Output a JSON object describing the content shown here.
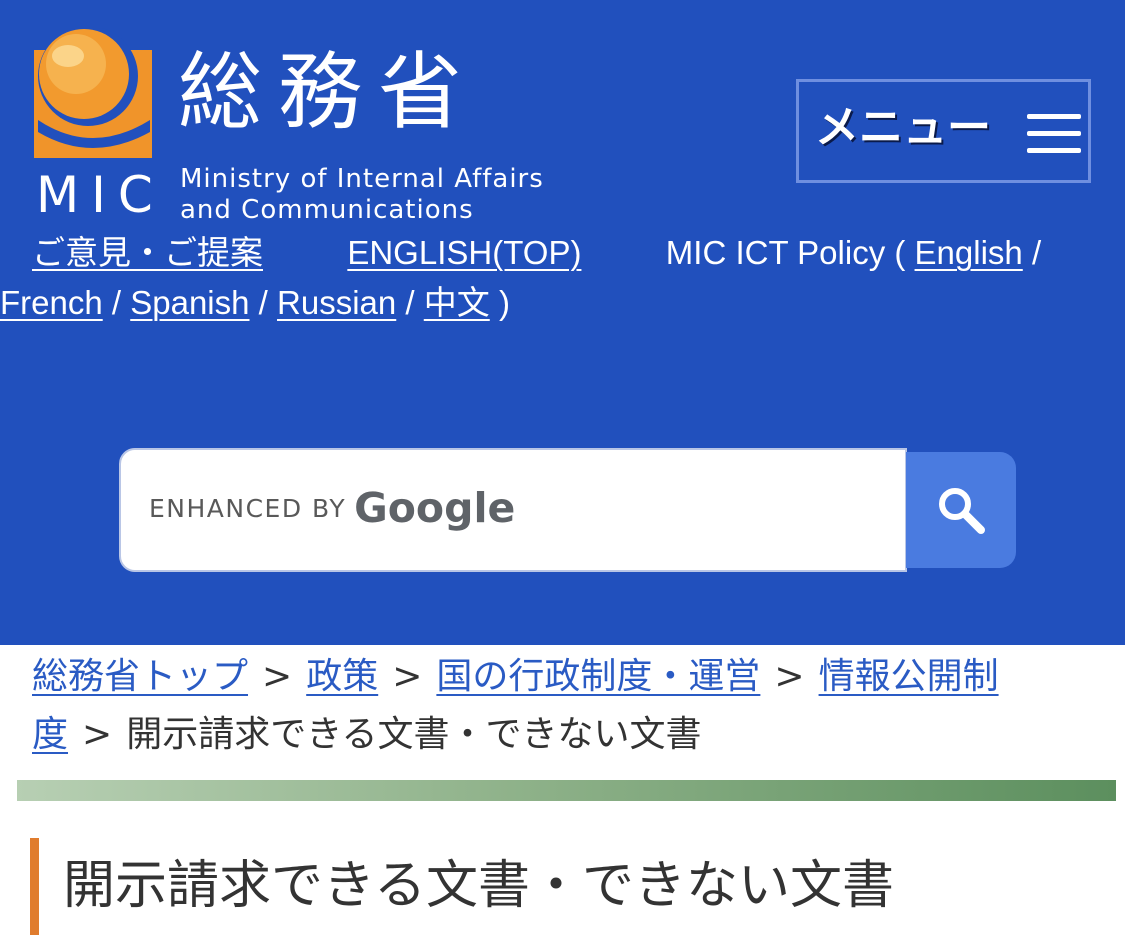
{
  "header": {
    "logo": {
      "kanji": "総務省",
      "abbr": "MIC",
      "english_line1": "Ministry of Internal Affairs",
      "english_line2": "and Communications"
    },
    "menu_label": "メニュー",
    "menu_icon": "hamburger-icon"
  },
  "top_links": {
    "opinion": "ご意見・ご提案",
    "english_top": "ENGLISH(TOP)",
    "ict_policy_prefix": "MIC ICT Policy",
    "open_paren": "(",
    "close_paren": ")",
    "slash": "/",
    "english": "English",
    "french": "French",
    "spanish": "Spanish",
    "russian": "Russian",
    "chinese": "中文"
  },
  "search": {
    "placeholder_small": "ENHANCED BY",
    "placeholder_brand": "Google",
    "button_icon": "search-icon"
  },
  "breadcrumb": {
    "items": [
      "総務省トップ",
      "政策",
      "国の行政制度・運営",
      "情報公開制",
      "度"
    ],
    "separator": ">",
    "current": "開示請求できる文書・できない文書"
  },
  "page": {
    "title": "開示請求できる文書・できない文書"
  },
  "colors": {
    "header_bg": "#2150bd",
    "link": "#2a5bc4",
    "search_button": "#4a7be0",
    "heading_accent": "#e07c2e",
    "logo_orange": "#f0942a"
  }
}
